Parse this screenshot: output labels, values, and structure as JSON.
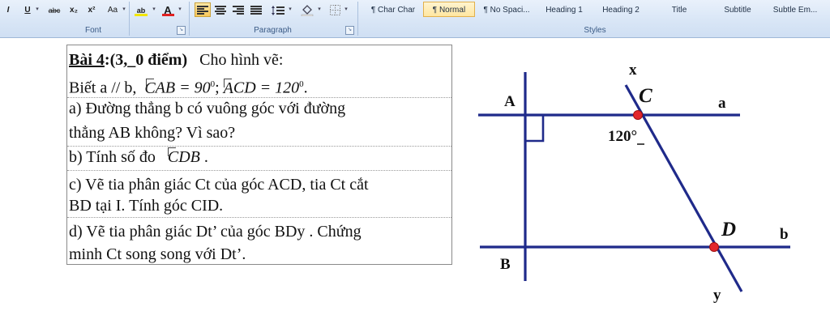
{
  "ribbon": {
    "font_group_label": "Font",
    "paragraph_group_label": "Paragraph",
    "styles_group_label": "Styles",
    "font_buttons": [
      "I",
      "U",
      "abc",
      "x₂",
      "x²",
      "Aa"
    ],
    "highlight_label": "ab",
    "font_color_label": "A",
    "styles": [
      "¶ Char Char",
      "¶ Normal",
      "¶ No Spaci...",
      "Heading 1",
      "Heading 2",
      "Title",
      "Subtitle",
      "Subtle Em..."
    ],
    "selected_style": "¶ Normal",
    "accent_color": "#f9c85c",
    "font_color_bar": "#e02020",
    "highlight_color_bar": "#f2e600"
  },
  "exercise": {
    "title_label": "Bài 4",
    "title_points": ":(3,_0 điểm)",
    "title_rest": "Cho hình vẽ:",
    "given_prefix": "Biết a // b,",
    "given_angle1_vertex": "C",
    "given_angle1_rest": "AB = 90",
    "given_angle1_deg": "0",
    "given_separator": ";",
    "given_angle2_vertex": "A",
    "given_angle2_rest": "CD = 120",
    "given_angle2_deg": "0",
    "given_end": ".",
    "part_a_line1": "a)  Đường thẳng b có vuông góc với đường",
    "part_a_line2": "thẳng AB không? Vì sao?",
    "part_b_prefix": "b)  Tính số đo",
    "part_b_angle": "CDB",
    "part_b_end": ".",
    "part_c_line1": "c)  Vẽ tia phân giác Ct của góc ACD, tia Ct cắt",
    "part_c_line2": "BD tại I. Tính góc CID.",
    "part_d_line1": "d)  Vẽ tia phân giác Dt’  của góc BDy . Chứng",
    "part_d_line2": "minh Ct song song với Dt’."
  },
  "figure": {
    "label_x": "x",
    "label_C": "C",
    "label_a": "a",
    "label_A": "A",
    "label_angle": "120°",
    "label_D": "D",
    "label_b": "b",
    "label_B": "B",
    "label_y": "y",
    "line_color": "#1f2a8a",
    "point_color": "#e3262c"
  }
}
